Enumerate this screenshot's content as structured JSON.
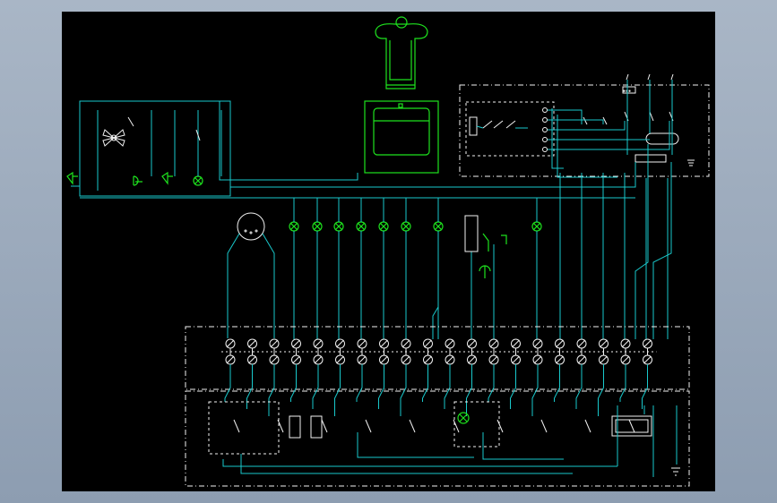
{
  "colors": {
    "background": "#000000",
    "window": "#98a8bb",
    "wire": "#19c9cc",
    "component": "#1ee21e",
    "border": "#f2f2f2"
  },
  "terminal_count": 20,
  "lamp_count": 10,
  "icons": [
    "fan-icon",
    "motor-icon",
    "lamp-icon",
    "speaker-icon",
    "bell-icon",
    "switch-icon",
    "terminal-icon",
    "ground-icon",
    "capacitor-icon",
    "indicator-icon"
  ]
}
